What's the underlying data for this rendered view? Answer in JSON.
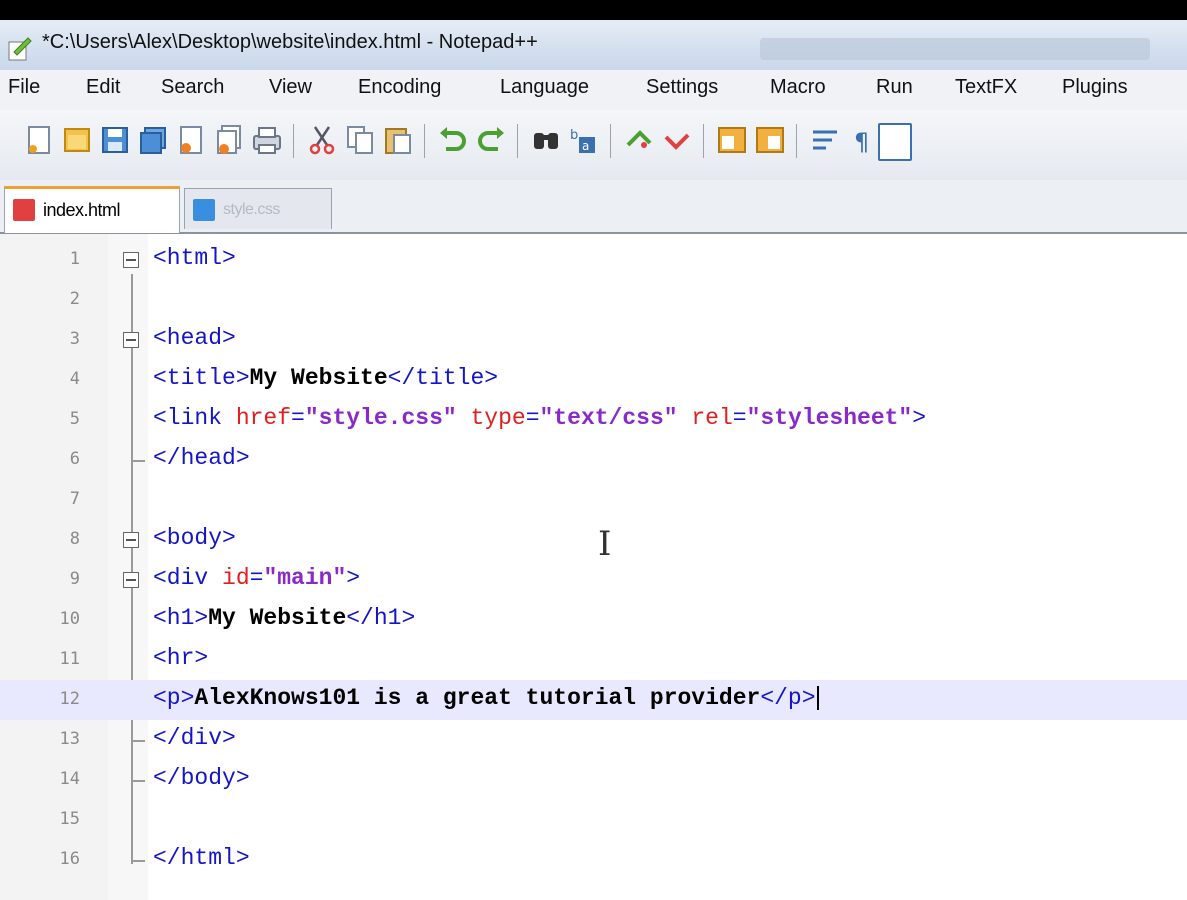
{
  "window": {
    "title": "*C:\\Users\\Alex\\Desktop\\website\\index.html - Notepad++"
  },
  "menu": [
    "File",
    "Edit",
    "Search",
    "View",
    "Encoding",
    "Language",
    "Settings",
    "Macro",
    "Run",
    "TextFX",
    "Plugins"
  ],
  "toolbar": {
    "icons": [
      "new-file-icon",
      "open-file-icon",
      "save-icon",
      "save-all-icon",
      "close-icon",
      "close-all-icon",
      "print-icon",
      "cut-icon",
      "copy-icon",
      "paste-icon",
      "undo-icon",
      "redo-icon",
      "find-icon",
      "replace-icon",
      "zoom-in-icon",
      "zoom-out-icon",
      "sync-vertical-icon",
      "sync-horizontal-icon",
      "word-wrap-icon",
      "show-all-chars-icon",
      "indent-guide-icon"
    ]
  },
  "tabs": [
    {
      "label": "index.html",
      "active": true,
      "icon_color": "#e04040"
    },
    {
      "label": "style.css",
      "active": false,
      "icon_color": "#3a8ee0"
    }
  ],
  "editor": {
    "current_line": 12,
    "lines": [
      {
        "num": "1",
        "tokens": [
          {
            "t": "tag",
            "v": "<html>"
          }
        ]
      },
      {
        "num": "2",
        "tokens": []
      },
      {
        "num": "3",
        "tokens": [
          {
            "t": "tag",
            "v": "<head>"
          }
        ]
      },
      {
        "num": "4",
        "tokens": [
          {
            "t": "tag",
            "v": "<title>"
          },
          {
            "t": "txt",
            "v": "My Website"
          },
          {
            "t": "tag",
            "v": "</title>"
          }
        ]
      },
      {
        "num": "5",
        "tokens": [
          {
            "t": "tag",
            "v": "<link "
          },
          {
            "t": "attr",
            "v": "href"
          },
          {
            "t": "tag",
            "v": "="
          },
          {
            "t": "str",
            "v": "\"style.css\""
          },
          {
            "t": "tag",
            "v": " "
          },
          {
            "t": "attr",
            "v": "type"
          },
          {
            "t": "tag",
            "v": "="
          },
          {
            "t": "str",
            "v": "\"text/css\""
          },
          {
            "t": "tag",
            "v": " "
          },
          {
            "t": "attr",
            "v": "rel"
          },
          {
            "t": "tag",
            "v": "="
          },
          {
            "t": "str",
            "v": "\"stylesheet\""
          },
          {
            "t": "tag",
            "v": ">"
          }
        ]
      },
      {
        "num": "6",
        "tokens": [
          {
            "t": "tag",
            "v": "</head>"
          }
        ]
      },
      {
        "num": "7",
        "tokens": []
      },
      {
        "num": "8",
        "tokens": [
          {
            "t": "tag",
            "v": "<body>"
          }
        ]
      },
      {
        "num": "9",
        "tokens": [
          {
            "t": "tag",
            "v": "<div "
          },
          {
            "t": "attr",
            "v": "id"
          },
          {
            "t": "tag",
            "v": "="
          },
          {
            "t": "str",
            "v": "\"main\""
          },
          {
            "t": "tag",
            "v": ">"
          }
        ]
      },
      {
        "num": "10",
        "tokens": [
          {
            "t": "tag",
            "v": "<h1>"
          },
          {
            "t": "txt",
            "v": "My Website"
          },
          {
            "t": "tag",
            "v": "</h1>"
          }
        ]
      },
      {
        "num": "11",
        "tokens": [
          {
            "t": "tag",
            "v": "<hr>"
          }
        ]
      },
      {
        "num": "12",
        "tokens": [
          {
            "t": "tag",
            "v": "<p>"
          },
          {
            "t": "txt",
            "v": "AlexKnows101 is a great tutorial provider"
          },
          {
            "t": "tag",
            "v": "</p>"
          }
        ]
      },
      {
        "num": "13",
        "tokens": [
          {
            "t": "tag",
            "v": "</div>"
          }
        ]
      },
      {
        "num": "14",
        "tokens": [
          {
            "t": "tag",
            "v": "</body>"
          }
        ]
      },
      {
        "num": "15",
        "tokens": []
      },
      {
        "num": "16",
        "tokens": [
          {
            "t": "tag",
            "v": "</html>"
          }
        ]
      }
    ]
  }
}
